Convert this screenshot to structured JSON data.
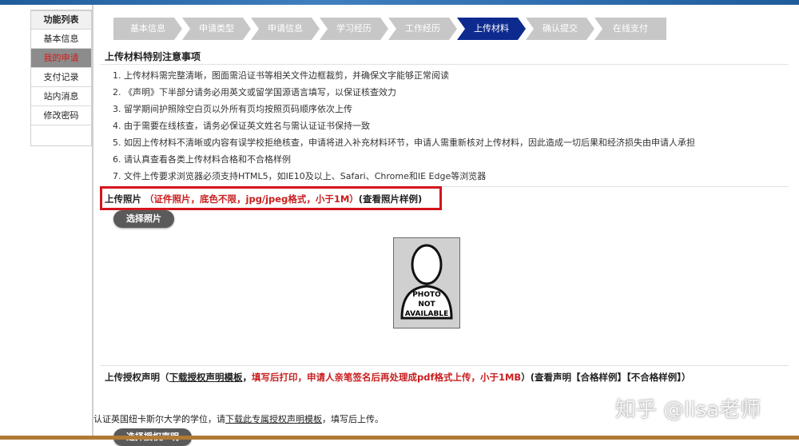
{
  "sidebar": {
    "title": "功能列表",
    "items": [
      {
        "label": "基本信息"
      },
      {
        "label": "我的申请"
      },
      {
        "label": "支付记录"
      },
      {
        "label": "站内消息"
      },
      {
        "label": "修改密码"
      }
    ]
  },
  "steps": [
    "基本信息",
    "申请类型",
    "申请信息",
    "学习经历",
    "工作经历",
    "上传材料",
    "确认提交",
    "在线支付"
  ],
  "notice": {
    "title": "上传材料特别注意事项",
    "items": [
      "1. 上传材料需完整清晰，图面需沿证书等相关文件边框裁剪，并确保文字能够正常阅读",
      "2. 《声明》下半部分请务必用英文或留学国源语言填写，以保证核查效力",
      "3. 留学期间护照除空白页以外所有页均按照页码顺序依次上传",
      "4. 由于需要在线核查，请务必保证英文姓名与需认证证书保持一致",
      "5. 如因上传材料不清晰或内容有误学校拒绝核查，申请将进入补充材料环节，申请人需重新核对上传材料，因此造成一切后果和经济损失由申请人承担",
      "6. 请认真查看各类上传材料合格和不合格样例",
      "7. 文件上传要求浏览器必须支持HTML5，如IE10及以上、Safari、Chrome和IE Edge等浏览器"
    ]
  },
  "photo_upload": {
    "label": "上传照片",
    "requirement": "（证件照片，底色不限，jpg/jpeg格式，小于1M）",
    "sample_link": "(查看照片样例)",
    "button": "选择照片",
    "placeholder": [
      "PHOTO",
      "NOT",
      "AVAILABLE"
    ]
  },
  "authorization": {
    "label": "上传授权声明",
    "open_paren": "（",
    "template_link": "下载授权声明模板",
    "comma": "，",
    "requirement": "填写后打印，申请人亲笔签名后再处理成pdf格式上传，小于1MB",
    "close_paren": "）",
    "view_statement": "(查看声明",
    "pass_sample": "【合格样例】",
    "fail_sample": "【不合格样例】",
    "end": "）",
    "note_prefix": "认证英国纽卡斯尔大学的学位，请",
    "note_link": "下载此专属授权声明模板",
    "note_suffix": "，填写后上传。",
    "button": "选择授权声明"
  },
  "watermark": "知乎 @lisa老师"
}
